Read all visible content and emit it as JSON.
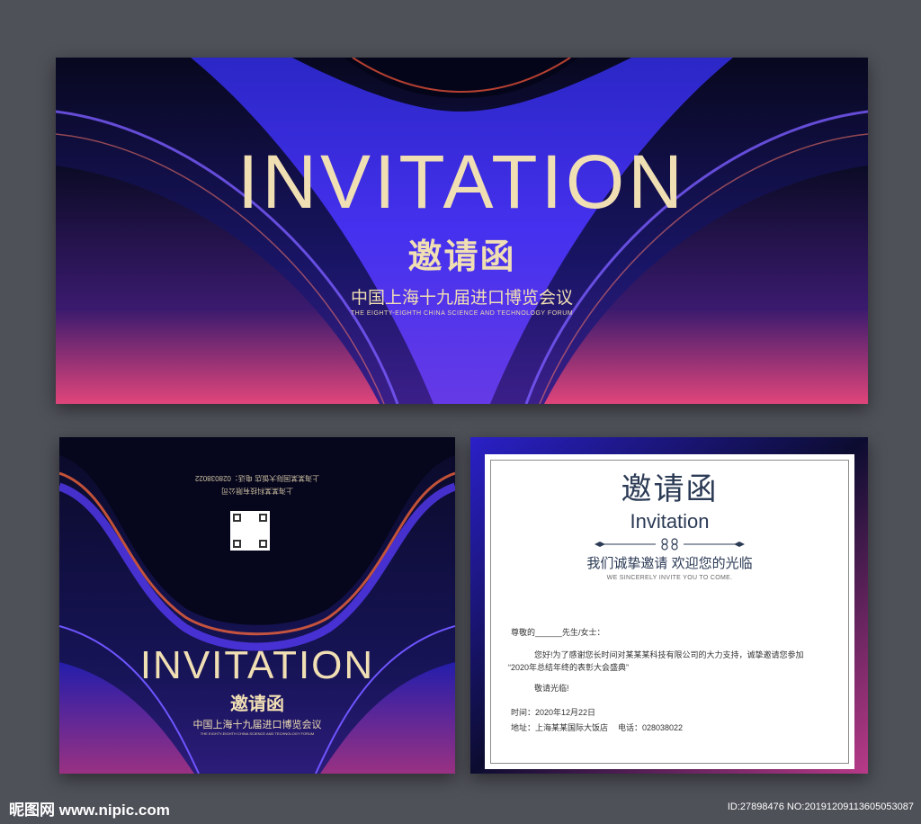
{
  "hero": {
    "title": "INVITATION",
    "cn_title": "邀请函",
    "subtitle": "中国上海十九届进口博览会议",
    "en_subtitle": "THE EIGHTY-EIGHTH CHINA SCIENCE AND TECHNOLOGY FORUM"
  },
  "back_cover": {
    "title": "INVITATION",
    "cn_title": "邀请函",
    "subtitle": "中国上海十九届进口博览会议",
    "en_subtitle": "THE EIGHTY-EIGHTH CHINA SCIENCE AND TECHNOLOGY FORUM",
    "flipped_line1": "上海某某国际大饭店 电话：028038022",
    "flipped_line2": "上海某某科技有限公司"
  },
  "inside": {
    "cn_title": "邀请函",
    "en_title": "Invitation",
    "slogan": "我们诚挚邀请 欢迎您的光临",
    "slogan_en": "WE SINCERELY INVITE YOU TO COME.",
    "salutation": "尊敬的______先生/女士：",
    "body_line1": "您好!为了感谢您长时间对某某某科技有限公司的大力支持，诚挚邀请您参加",
    "body_line2": "“2020年总结年终的表彰大会盛典”",
    "closing": "敬请光临!",
    "time": "时间：2020年12月22日",
    "address": "地址：上海某某国际大饭店",
    "phone": "电话：028038022"
  },
  "footer": {
    "logo": "昵图网 www.nipic.com",
    "id": "ID:27898476 NO:20191209113605053087"
  },
  "colors": {
    "background": "#4f5159",
    "gold_text": "#f1dfb4",
    "card_dark": "#0a0a2a",
    "neon_blue": "#3a2cff",
    "magenta": "#d4407a",
    "ink": "#2b3a55"
  }
}
